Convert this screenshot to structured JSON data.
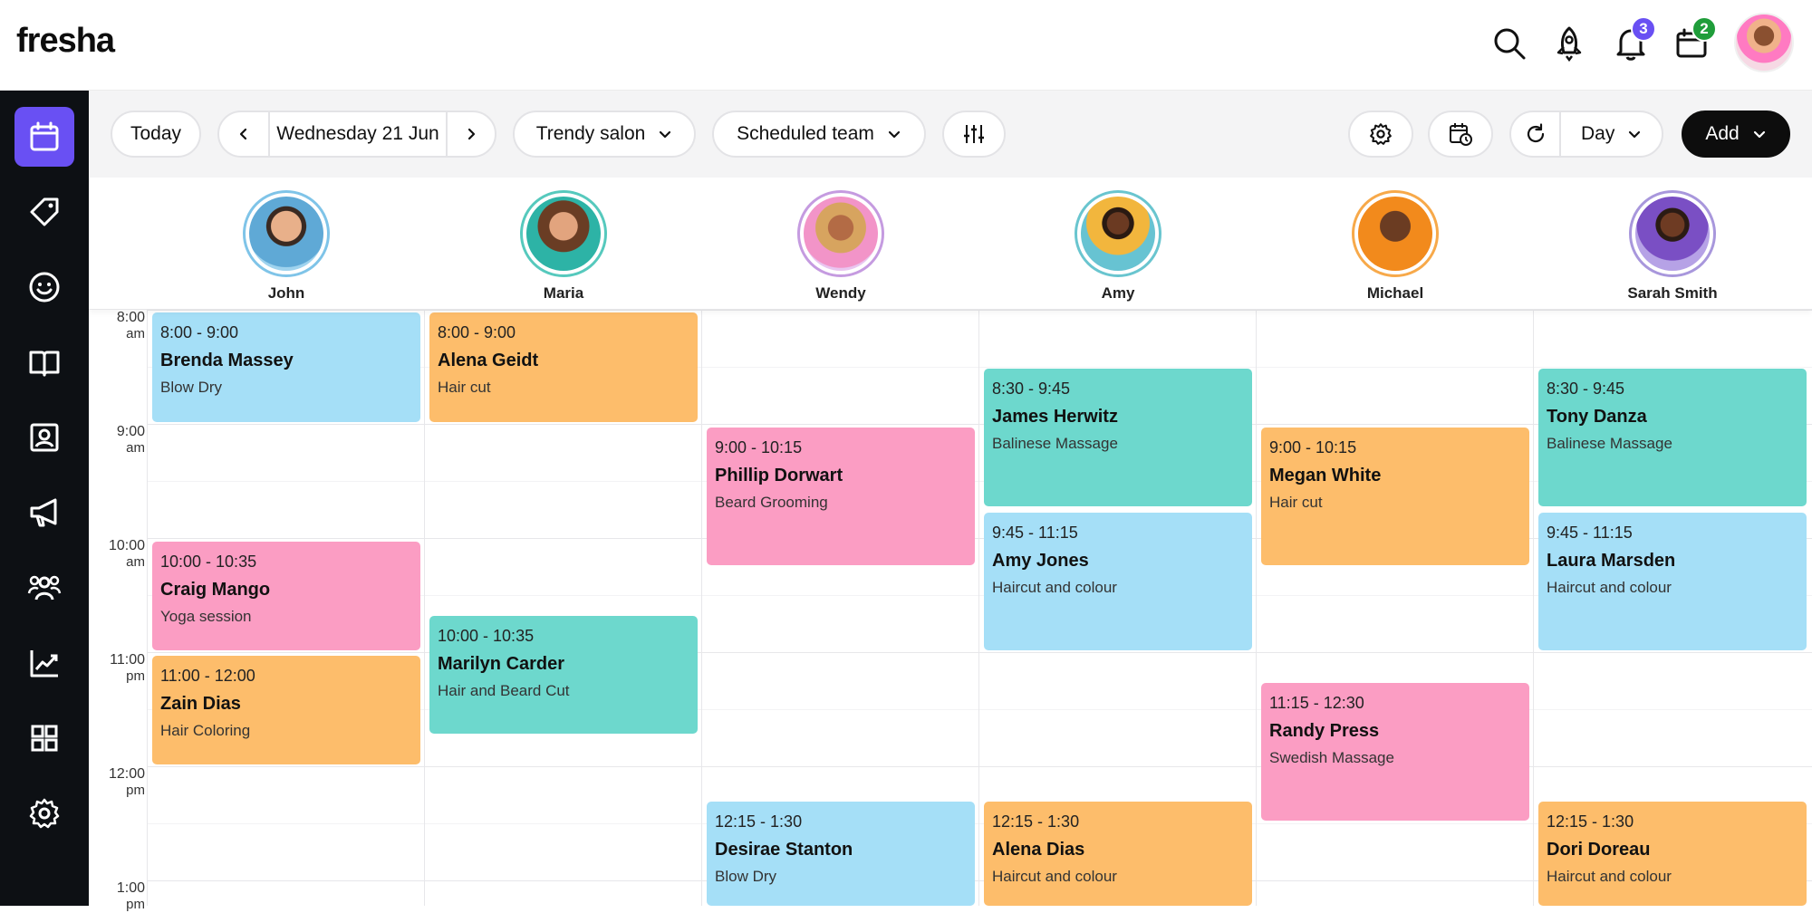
{
  "app": {
    "logo": "fresha"
  },
  "topbar": {
    "notifications_count": "3",
    "inbox_count": "2",
    "colors": {
      "notif_badge": "#6950f3",
      "inbox_badge": "#1f9d3a"
    }
  },
  "sidebar": {
    "items": [
      {
        "name": "calendar",
        "active": true
      },
      {
        "name": "sales"
      },
      {
        "name": "clients"
      },
      {
        "name": "catalog"
      },
      {
        "name": "team"
      },
      {
        "name": "marketing"
      },
      {
        "name": "groups"
      },
      {
        "name": "reports"
      },
      {
        "name": "apps"
      },
      {
        "name": "settings"
      }
    ]
  },
  "toolbar": {
    "today_label": "Today",
    "date_label": "Wednesday 21 Jun",
    "location_label": "Trendy salon",
    "team_label": "Scheduled team",
    "view_label": "Day",
    "add_label": "Add"
  },
  "staff": [
    {
      "name": "John",
      "ring": "#7fc4e8"
    },
    {
      "name": "Maria",
      "ring": "#56c9bd"
    },
    {
      "name": "Wendy",
      "ring": "#c59be0"
    },
    {
      "name": "Amy",
      "ring": "#69c5cf"
    },
    {
      "name": "Michael",
      "ring": "#f7a94a"
    },
    {
      "name": "Sarah Smith",
      "ring": "#a897dc"
    }
  ],
  "times": [
    {
      "hour": "8:00",
      "ampm": "am"
    },
    {
      "hour": "9:00",
      "ampm": "am"
    },
    {
      "hour": "10:00",
      "ampm": "am"
    },
    {
      "hour": "11:00",
      "ampm": "pm"
    },
    {
      "hour": "12:00",
      "ampm": "pm"
    },
    {
      "hour": "1:00",
      "ampm": "pm"
    }
  ],
  "appointments": [
    {
      "time": "8:00 - 9:00",
      "client": "Brenda Massey",
      "service": "Blow Dry"
    },
    {
      "time": "10:00 - 10:35",
      "client": "Craig Mango",
      "service": "Yoga session"
    },
    {
      "time": "11:00 - 12:00",
      "client": "Zain Dias",
      "service": "Hair Coloring"
    },
    {
      "time": "8:00 - 9:00",
      "client": "Alena Geidt",
      "service": "Hair cut"
    },
    {
      "time": "10:00 - 10:35",
      "client": "Marilyn Carder",
      "service": "Hair and Beard Cut"
    },
    {
      "time": "9:00 - 10:15",
      "client": "Phillip Dorwart",
      "service": "Beard Grooming"
    },
    {
      "time": "12:15 - 1:30",
      "client": "Desirae Stanton",
      "service": "Blow Dry"
    },
    {
      "time": "8:30 - 9:45",
      "client": "James Herwitz",
      "service": "Balinese Massage"
    },
    {
      "time": "9:45 - 11:15",
      "client": "Amy Jones",
      "service": "Haircut and colour"
    },
    {
      "time": "12:15 - 1:30",
      "client": "Alena Dias",
      "service": "Haircut and colour"
    },
    {
      "time": "9:00 - 10:15",
      "client": "Megan White",
      "service": "Hair cut"
    },
    {
      "time": "11:15 - 12:30",
      "client": "Randy Press",
      "service": "Swedish Massage"
    },
    {
      "time": "8:30 - 9:45",
      "client": "Tony Danza",
      "service": "Balinese Massage"
    },
    {
      "time": "9:45 - 11:15",
      "client": "Laura Marsden",
      "service": "Haircut and colour"
    },
    {
      "time": "12:15 - 1:30",
      "client": "Dori Doreau",
      "service": "Haircut and colour"
    }
  ],
  "colors": {
    "blue": "#a5dff7",
    "orange": "#fdbd6b",
    "pink": "#fb9dc3",
    "teal": "#6dd8cd",
    "accent": "#6950f3",
    "sidebar": "#0d1014"
  }
}
